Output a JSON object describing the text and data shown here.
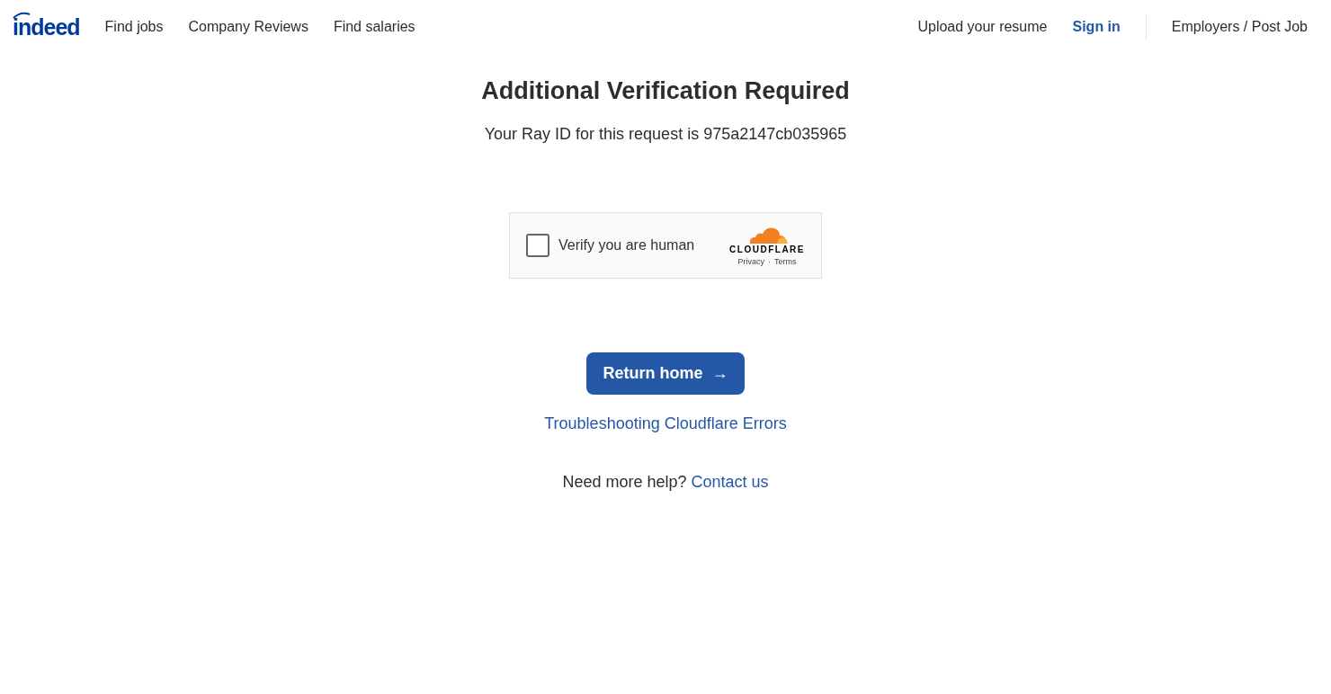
{
  "header": {
    "logo": "indeed",
    "nav": [
      "Find jobs",
      "Company Reviews",
      "Find salaries"
    ],
    "upload": "Upload your resume",
    "sign_in": "Sign in",
    "employers": "Employers / Post Job"
  },
  "main": {
    "title": "Additional Verification Required",
    "ray_id": "Your Ray ID for this request is 975a2147cb035965",
    "captcha": {
      "label": "Verify you are human",
      "checked": false,
      "brand": "CLOUDFLARE",
      "privacy": "Privacy",
      "separator": "·",
      "terms": "Terms"
    },
    "button": "Return home",
    "arrow": "→",
    "troubleshoot": "Troubleshooting Cloudflare Errors",
    "help": "Need more help?",
    "contact": "Contact us"
  }
}
